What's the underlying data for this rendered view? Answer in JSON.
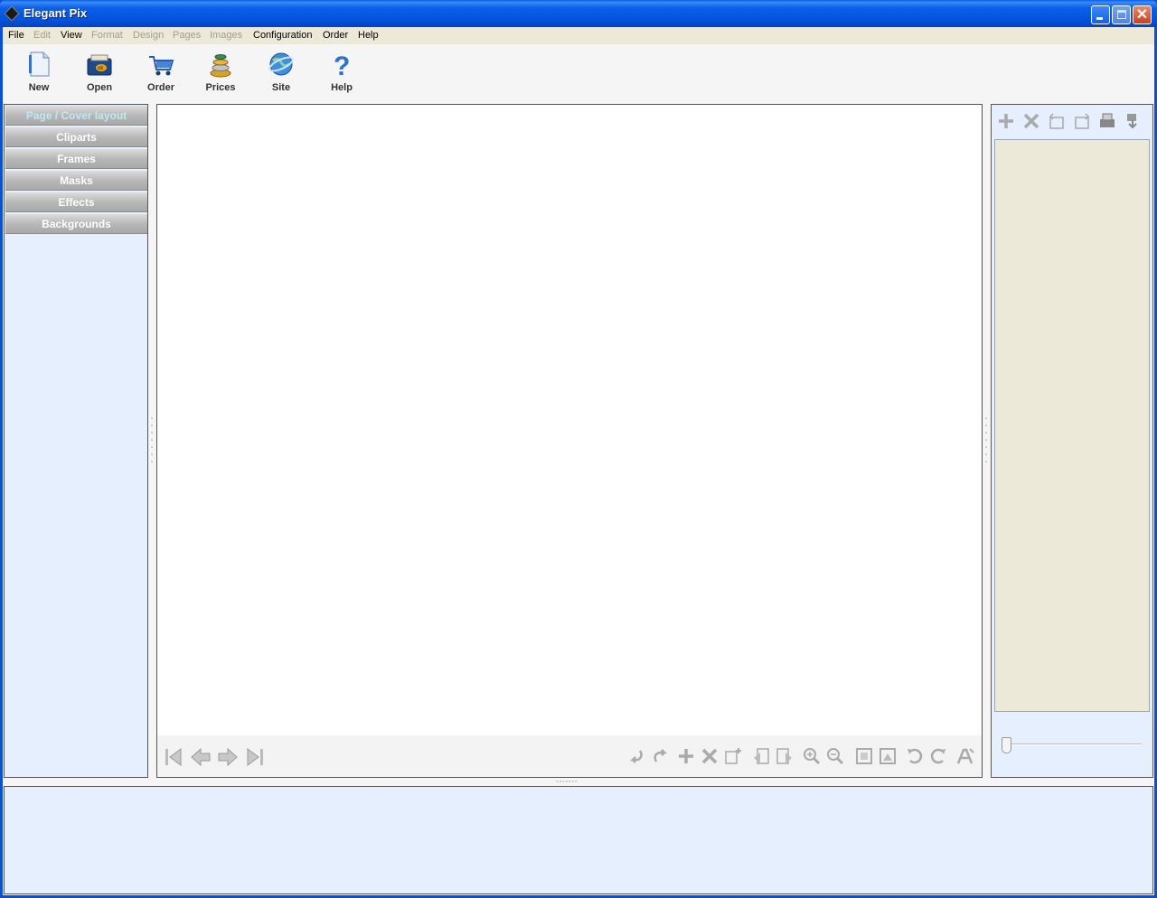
{
  "window": {
    "title": "Elegant Pix"
  },
  "menu": {
    "items": [
      {
        "label": "File",
        "enabled": true
      },
      {
        "label": "Edit",
        "enabled": false
      },
      {
        "label": "View",
        "enabled": true
      },
      {
        "label": "Format",
        "enabled": false
      },
      {
        "label": "Design",
        "enabled": false
      },
      {
        "label": "Pages",
        "enabled": false
      },
      {
        "label": "Images",
        "enabled": false
      },
      {
        "label": "Configuration",
        "enabled": true
      },
      {
        "label": "Order",
        "enabled": true
      },
      {
        "label": "Help",
        "enabled": true
      }
    ]
  },
  "toolbar": {
    "items": [
      {
        "label": "New",
        "icon": "new-document-icon"
      },
      {
        "label": "Open",
        "icon": "open-album-icon"
      },
      {
        "label": "Order",
        "icon": "shopping-cart-icon"
      },
      {
        "label": "Prices",
        "icon": "coins-stack-icon"
      },
      {
        "label": "Site",
        "icon": "globe-icon"
      },
      {
        "label": "Help",
        "icon": "question-mark-icon"
      }
    ]
  },
  "left_panel": {
    "buttons": [
      {
        "label": "Page / Cover layout",
        "active": true
      },
      {
        "label": "Cliparts",
        "active": false
      },
      {
        "label": "Frames",
        "active": false
      },
      {
        "label": "Masks",
        "active": false
      },
      {
        "label": "Effects",
        "active": false
      },
      {
        "label": "Backgrounds",
        "active": false
      }
    ]
  },
  "canvas": {
    "nav_icons": [
      "first-page-icon",
      "previous-page-icon",
      "next-page-icon",
      "last-page-icon"
    ],
    "tool_icons": [
      "undo-icon",
      "redo-icon",
      "add-icon",
      "delete-icon",
      "insert-page-icon",
      "move-left-icon",
      "move-right-icon",
      "zoom-in-icon",
      "zoom-out-icon",
      "fit-page-icon",
      "actual-size-icon",
      "rotate-left-icon",
      "rotate-right-icon",
      "text-icon"
    ]
  },
  "right_panel": {
    "tool_icons": [
      "add-image-icon",
      "remove-image-icon",
      "rotate-image-left-icon",
      "rotate-image-right-icon",
      "scanner-icon",
      "import-icon"
    ],
    "thumbnail_zoom": 0
  },
  "colors": {
    "title_bar": "#0554de",
    "panel_bg": "#e5effd",
    "menu_bg": "#ece9d8",
    "thumb_bg": "#ece9d8",
    "active_tab_text": "#bfe8f4"
  }
}
